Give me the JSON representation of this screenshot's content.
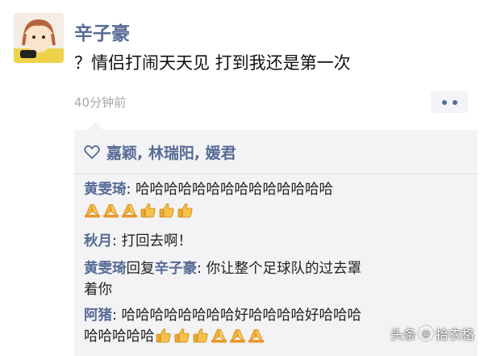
{
  "post": {
    "poster_name": "辛子豪",
    "text": "？情侣打闹天天见 打到我还是第一次",
    "time": "40分钟前"
  },
  "likes": {
    "icon": "heart-outline-icon",
    "names": "嘉颖, 林瑞阳, 媛君"
  },
  "comments": [
    {
      "name": "黄雯琦",
      "separator": ": ",
      "text": "哈哈哈哈哈哈哈哈哈哈哈哈哈哈",
      "emojis": [
        "pray",
        "pray",
        "pray",
        "thumbsup",
        "thumbsup",
        "thumbsup"
      ]
    },
    {
      "name": "秋月",
      "separator": ": ",
      "text": "打回去啊！"
    },
    {
      "name": "黄雯琦",
      "reply_word": "回复",
      "reply_to": "辛子豪",
      "separator": ": ",
      "text_line1": "你让整个足球队的过去罩",
      "text_line2": "着你"
    },
    {
      "name": "阿猪",
      "separator": ": ",
      "text_line1": "哈哈哈哈哈哈哈哈好哈哈哈哈好哈哈哈",
      "text_line2": "哈哈哈哈哈",
      "emojis": [
        "thumbsup",
        "thumbsup",
        "thumbsup",
        "pray",
        "pray",
        "pray"
      ]
    }
  ],
  "watermark": {
    "prefix": "头条",
    "handle": "拾衣格"
  },
  "colors": {
    "name_blue": "#576b95",
    "box_bg": "#f3f3f5",
    "time_gray": "#a8a8a8"
  }
}
